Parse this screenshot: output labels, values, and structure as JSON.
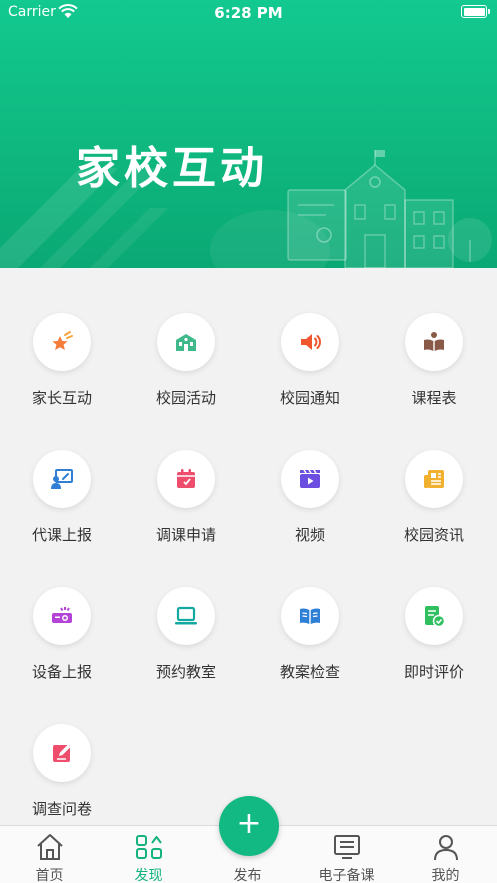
{
  "status_bar": {
    "carrier": "Carrier",
    "time": "6:28 PM"
  },
  "banner": {
    "title": "家校互动"
  },
  "features": [
    {
      "label": "家长互动",
      "icon": "star-icon",
      "color": "#f57c3a"
    },
    {
      "label": "校园活动",
      "icon": "school-building-icon",
      "color": "#3fb88a"
    },
    {
      "label": "校园通知",
      "icon": "speaker-icon",
      "color": "#f0562e"
    },
    {
      "label": "课程表",
      "icon": "book-reader-icon",
      "color": "#8a5a48"
    },
    {
      "label": "代课上报",
      "icon": "teacher-board-icon",
      "color": "#2f7fd6"
    },
    {
      "label": "调课申请",
      "icon": "calendar-icon",
      "color": "#ee4e6c"
    },
    {
      "label": "视频",
      "icon": "video-icon",
      "color": "#6c4fe0"
    },
    {
      "label": "校园资讯",
      "icon": "newspaper-icon",
      "color": "#f2b02f"
    },
    {
      "label": "设备上报",
      "icon": "projector-icon",
      "color": "#b543d8"
    },
    {
      "label": "预约教室",
      "icon": "laptop-icon",
      "color": "#14a9a0"
    },
    {
      "label": "教案检查",
      "icon": "open-book-icon",
      "color": "#2e7fd6"
    },
    {
      "label": "即时评价",
      "icon": "checklist-icon",
      "color": "#2fbf5f"
    },
    {
      "label": "调查问卷",
      "icon": "edit-icon",
      "color": "#ee4e6c"
    }
  ],
  "tabbar": {
    "tabs": [
      {
        "label": "首页",
        "icon": "home-icon",
        "active": false
      },
      {
        "label": "发现",
        "icon": "discover-grid-icon",
        "active": true
      },
      {
        "label": "发布",
        "icon": "plus-icon",
        "active": false
      },
      {
        "label": "电子备课",
        "icon": "document-screen-icon",
        "active": false
      },
      {
        "label": "我的",
        "icon": "user-icon",
        "active": false
      }
    ],
    "publish_symbol": "+"
  },
  "colors": {
    "accent": "#13b27f",
    "banner": "#10c088",
    "background": "#f2f2f2"
  }
}
